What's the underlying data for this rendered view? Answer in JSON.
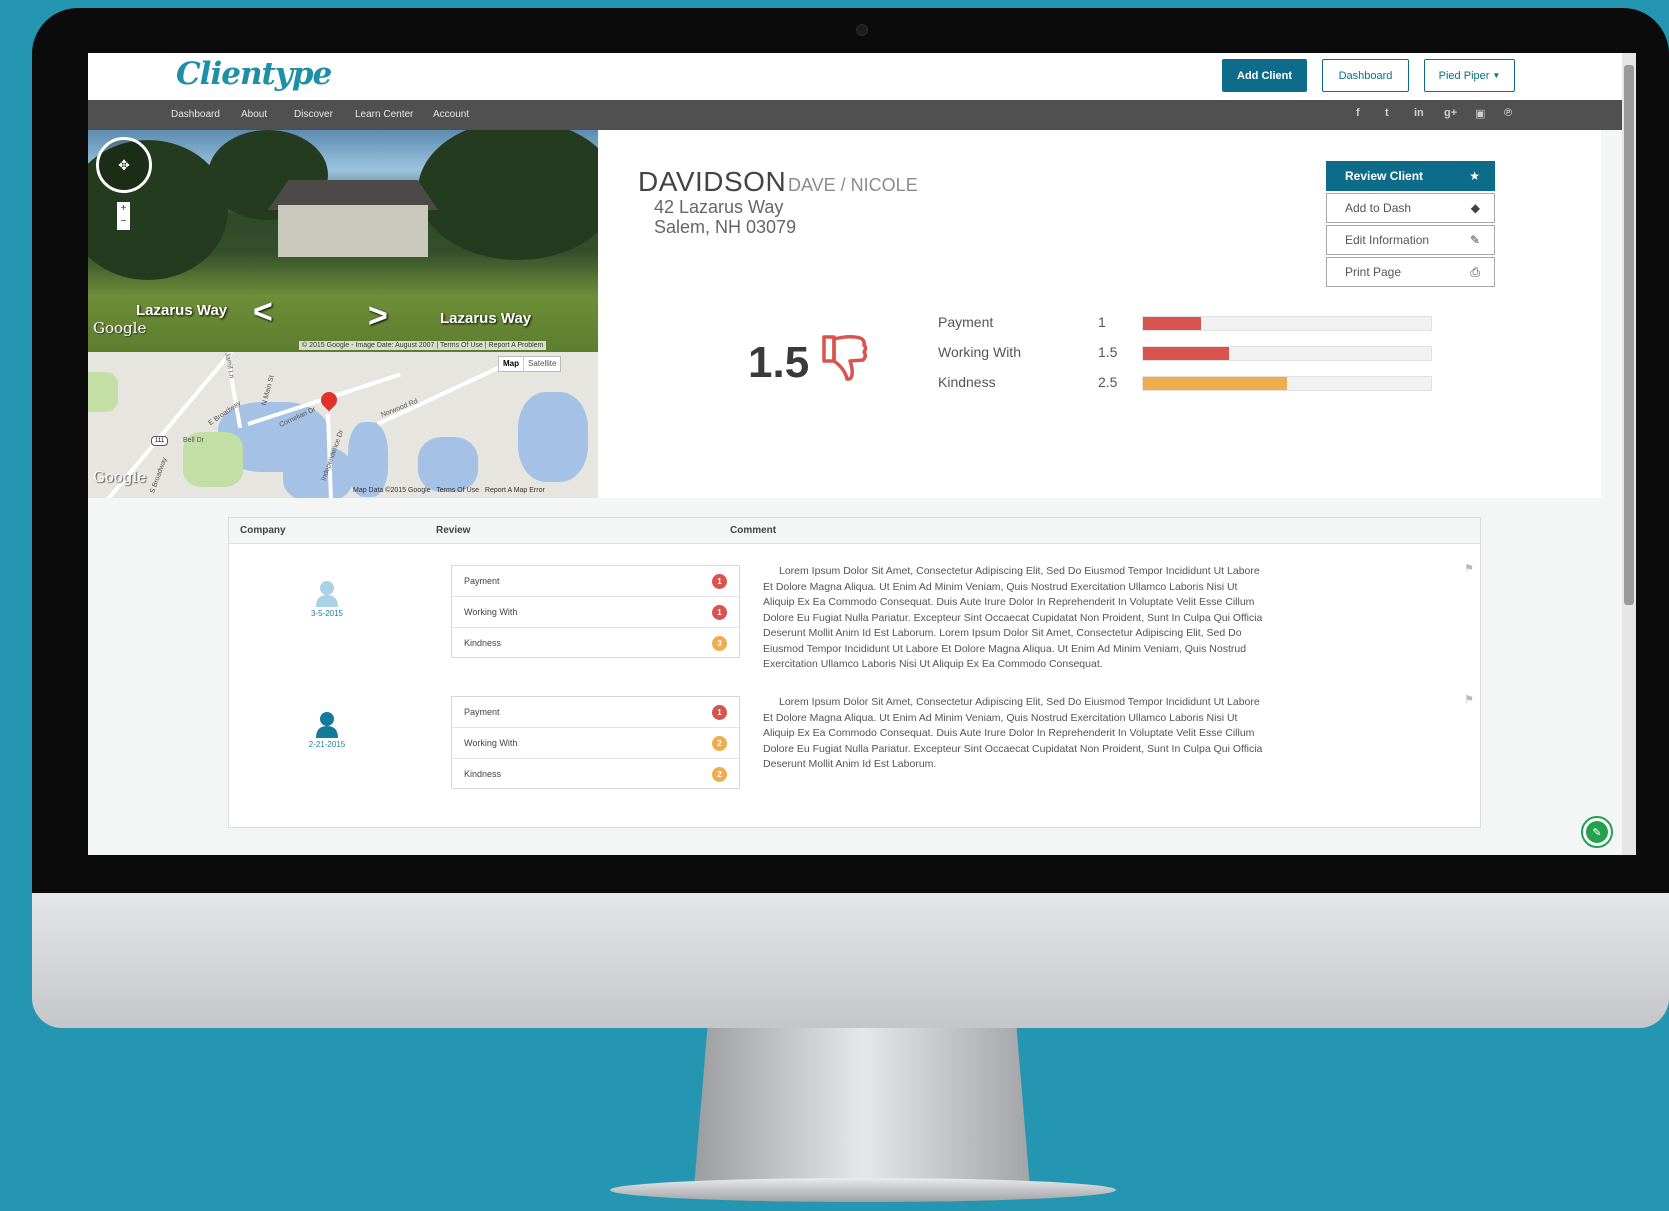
{
  "app": {
    "logo": "Clientype"
  },
  "header": {
    "add_client": "Add Client",
    "dashboard": "Dashboard",
    "account_menu": "Pied Piper"
  },
  "nav": {
    "items": [
      "Dashboard",
      "About",
      "Discover",
      "Learn Center",
      "Account"
    ]
  },
  "social_icons": [
    "facebook-icon",
    "twitter-icon",
    "linkedin-icon",
    "google-plus-icon",
    "youtube-icon",
    "pinterest-icon"
  ],
  "social_glyphs": [
    "f",
    "t",
    "in",
    "g+",
    "▣",
    "℗"
  ],
  "streetview": {
    "street_left": "Lazarus Way",
    "street_right": "Lazarus Way",
    "google": "Google",
    "credit": "© 2015 Google - Image Date: August 2007",
    "terms": "Terms Of Use",
    "report": "Report A Problem"
  },
  "map": {
    "map_button": "Map",
    "satellite_button": "Satellite",
    "google": "Google",
    "credit": "Map Data ©2015 Google",
    "terms": "Terms Of Use",
    "report": "Report A Map Error",
    "route_number": "111",
    "road_labels": [
      "Jamil Ln",
      "N Main St",
      "E Broadway",
      "Cornelian Dr",
      "Norwood Rd",
      "Bell Dr",
      "Independence Dr",
      "S Broadway"
    ]
  },
  "client": {
    "last_name": "DAVIDSON",
    "first_names": "DAVE  /  NICOLE",
    "address_line1": "42 Lazarus Way",
    "address_line2": "Salem, NH  03079",
    "overall_score": "1.5"
  },
  "actions": {
    "review": "Review Client",
    "add_to_dash": "Add to Dash",
    "edit": "Edit Information",
    "print": "Print Page"
  },
  "ratings": [
    {
      "label": "Payment",
      "value": "1",
      "fraction": 0.2,
      "color": "#d9534f"
    },
    {
      "label": "Working With",
      "value": "1.5",
      "fraction": 0.3,
      "color": "#d9534f"
    },
    {
      "label": "Kindness",
      "value": "2.5",
      "fraction": 0.5,
      "color": "#f0ad4e"
    }
  ],
  "table": {
    "headers": {
      "company": "Company",
      "review": "Review",
      "comment": "Comment"
    },
    "rows": [
      {
        "date": "3-5-2015",
        "avatar_color": "#a9d3e4",
        "items": [
          {
            "label": "Payment",
            "value": "1",
            "color": "#d9534f"
          },
          {
            "label": "Working With",
            "value": "1",
            "color": "#d9534f"
          },
          {
            "label": "Kindness",
            "value": "3",
            "color": "#f0ad4e"
          }
        ],
        "comment": "Lorem Ipsum Dolor Sit Amet, Consectetur Adipiscing Elit, Sed Do Eiusmod Tempor Incididunt Ut Labore Et Dolore Magna Aliqua. Ut Enim Ad Minim Veniam, Quis Nostrud Exercitation Ullamco Laboris Nisi Ut Aliquip Ex Ea Commodo Consequat. Duis Aute Irure Dolor In Reprehenderit In Voluptate Velit Esse Cillum Dolore Eu Fugiat Nulla Pariatur. Excepteur Sint Occaecat Cupidatat Non Proident, Sunt In Culpa Qui Officia Deserunt Mollit Anim Id Est Laborum. Lorem Ipsum Dolor Sit Amet, Consectetur Adipiscing Elit, Sed Do Eiusmod Tempor Incididunt Ut Labore Et Dolore Magna Aliqua. Ut Enim Ad Minim Veniam, Quis Nostrud Exercitation Ullamco Laboris Nisi Ut Aliquip Ex Ea Commodo Consequat."
      },
      {
        "date": "2-21-2015",
        "avatar_color": "#137a9a",
        "items": [
          {
            "label": "Payment",
            "value": "1",
            "color": "#d9534f"
          },
          {
            "label": "Working With",
            "value": "2",
            "color": "#f0ad4e"
          },
          {
            "label": "Kindness",
            "value": "2",
            "color": "#f0ad4e"
          }
        ],
        "comment": "Lorem Ipsum Dolor Sit Amet, Consectetur Adipiscing Elit, Sed Do Eiusmod Tempor Incididunt Ut Labore Et Dolore Magna Aliqua. Ut Enim Ad Minim Veniam, Quis Nostrud Exercitation Ullamco Laboris Nisi Ut Aliquip Ex Ea Commodo Consequat. Duis Aute Irure Dolor In Reprehenderit In Voluptate Velit Esse Cillum Dolore Eu Fugiat Nulla Pariatur. Excepteur Sint Occaecat Cupidatat Non Proident, Sunt In Culpa Qui Officia Deserunt Mollit Anim Id Est Laborum."
      }
    ]
  },
  "colors": {
    "brand": "#0e6c8b",
    "nav_bg": "#505050",
    "background": "#2596b1",
    "fab": "#22a24e"
  }
}
